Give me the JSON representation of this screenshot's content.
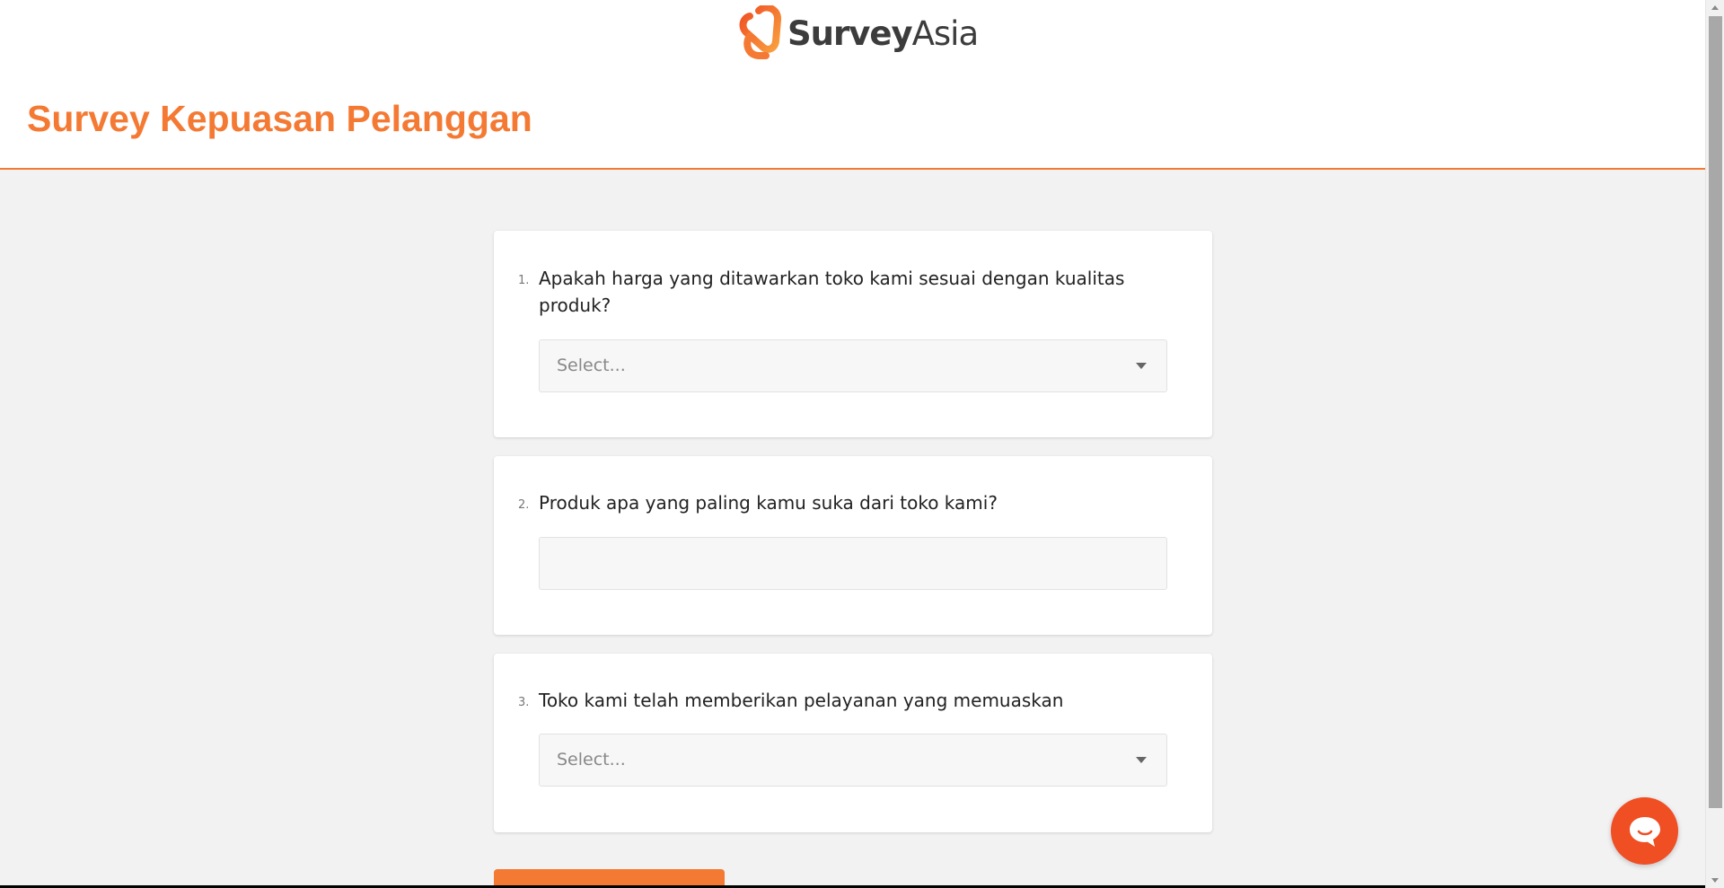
{
  "brand": {
    "logo_bold": "Survey",
    "logo_light": "Asia",
    "accent_color": "#f47a34"
  },
  "survey": {
    "title": "Survey Kepuasan Pelanggan"
  },
  "questions": [
    {
      "number": "1.",
      "text": "Apakah harga yang ditawarkan toko kami sesuai dengan kualitas produk?",
      "input_type": "select",
      "placeholder": "Select..."
    },
    {
      "number": "2.",
      "text": "Produk apa yang paling kamu suka dari toko kami?",
      "input_type": "text",
      "value": ""
    },
    {
      "number": "3.",
      "text": "Toko kami telah memberikan pelayanan yang memuaskan",
      "input_type": "select",
      "placeholder": "Select..."
    }
  ],
  "icons": {
    "logo": "surveyasia-logo-icon",
    "chat": "chat-bubble-icon",
    "dropdown": "chevron-down-icon"
  }
}
